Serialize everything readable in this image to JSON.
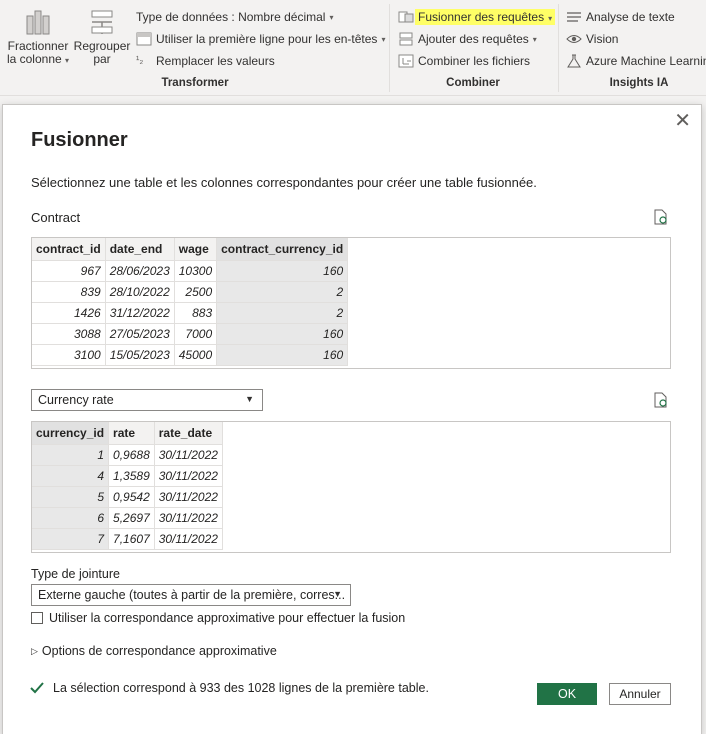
{
  "ribbon": {
    "split_column": {
      "line1": "Fractionner",
      "line2": "la colonne"
    },
    "group_by": {
      "line1": "Regrouper",
      "line2": "par"
    },
    "data_type": "Type de données : Nombre décimal",
    "first_row_headers": "Utiliser la première ligne pour les en-têtes",
    "replace_values": "Remplacer les valeurs",
    "transform_group": "Transformer",
    "merge_queries": "Fusionner des requêtes",
    "append_queries": "Ajouter des requêtes",
    "combine_files": "Combiner les fichiers",
    "combine_group": "Combiner",
    "text_analytics": "Analyse de texte",
    "vision": "Vision",
    "azure_ml": "Azure Machine Learning",
    "ai_group": "Insights IA",
    "highlight_color": "#ffff66"
  },
  "dialog": {
    "title": "Fusionner",
    "subtitle": "Sélectionnez une table et les colonnes correspondantes pour créer une table fusionnée.",
    "table1_name": "Contract",
    "table1": {
      "columns": [
        "contract_id",
        "date_end",
        "wage",
        "contract_currency_id"
      ],
      "rows": [
        [
          "967",
          "28/06/2023",
          "10300",
          "160"
        ],
        [
          "839",
          "28/10/2022",
          "2500",
          "2"
        ],
        [
          "1426",
          "31/12/2022",
          "883",
          "2"
        ],
        [
          "3088",
          "27/05/2023",
          "7000",
          "160"
        ],
        [
          "3100",
          "15/05/2023",
          "45000",
          "160"
        ]
      ],
      "selected_column": 3
    },
    "table2_select": "Currency rate",
    "table2": {
      "columns": [
        "currency_id",
        "rate",
        "rate_date"
      ],
      "rows": [
        [
          "1",
          "0,9688",
          "30/11/2022"
        ],
        [
          "4",
          "1,3589",
          "30/11/2022"
        ],
        [
          "5",
          "0,9542",
          "30/11/2022"
        ],
        [
          "6",
          "5,2697",
          "30/11/2022"
        ],
        [
          "7",
          "7,1607",
          "30/11/2022"
        ]
      ],
      "selected_column": 0
    },
    "join_type_label": "Type de jointure",
    "join_type_value": "Externe gauche (toutes à partir de la première, corres...",
    "fuzzy_checkbox": "Utiliser la correspondance approximative pour effectuer la fusion",
    "fuzzy_options": "Options de correspondance approximative",
    "status": "La sélection correspond à 933 des 1028 lignes de la première table.",
    "ok": "OK",
    "cancel": "Annuler",
    "accent_color": "#217346"
  }
}
